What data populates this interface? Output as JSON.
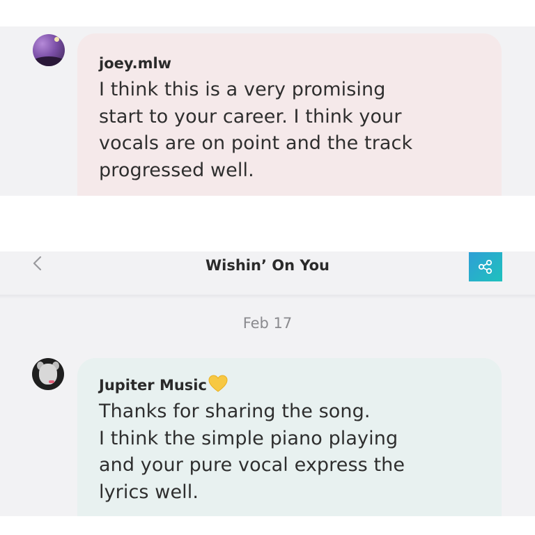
{
  "comment_top": {
    "author": "joey.mlw",
    "lines": [
      "I think this is a very promising",
      "start to your career. I think your",
      "vocals are on point and the track",
      "progressed well."
    ],
    "avatar_icon": "night-sky-avatar"
  },
  "header": {
    "title": "Wishin’ On You",
    "back_icon": "chevron-left-icon",
    "share_icon": "share-icon",
    "share_gradient": [
      "#2f9fd6",
      "#1fc1bd"
    ]
  },
  "date": "Feb 17",
  "comment_bottom": {
    "author": "Jupiter Music",
    "badge_icon": "yellow-heart-icon",
    "lines": [
      "Thanks for sharing the song.",
      "I think the simple piano playing",
      "and your pure vocal express the",
      "lyrics well."
    ],
    "avatar_icon": "toy-figure-avatar"
  },
  "colors": {
    "background": "#f2f2f4",
    "bubble_pink": "#f5e9ea",
    "bubble_teal": "#e8f1f0",
    "heart": "#f7c843"
  }
}
